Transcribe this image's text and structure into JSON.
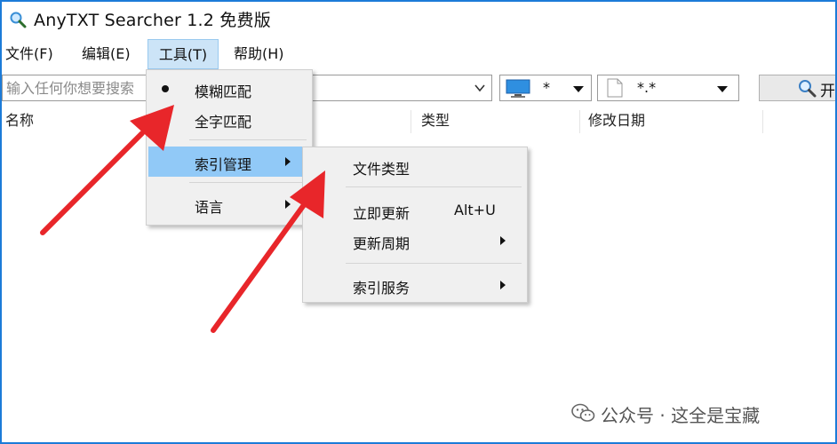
{
  "window": {
    "title": "AnyTXT Searcher 1.2 免费版"
  },
  "menubar": {
    "items": [
      {
        "label": "文件(F)"
      },
      {
        "label": "编辑(E)"
      },
      {
        "label": "工具(T)"
      },
      {
        "label": "帮助(H)"
      }
    ]
  },
  "toolbar": {
    "search_placeholder": "输入任何你想要搜索",
    "location_value": "*",
    "filetype_value": "*.*",
    "search_button_label": "开"
  },
  "columns": [
    "名称",
    "类型",
    "修改日期"
  ],
  "tools_menu": {
    "items": [
      {
        "label": "模糊匹配",
        "checked": true
      },
      {
        "label": "全字匹配"
      },
      {
        "label": "索引管理",
        "highlighted": true,
        "has_submenu": true
      },
      {
        "label": "语言",
        "has_submenu": true
      }
    ]
  },
  "index_submenu": {
    "items": [
      {
        "label": "文件类型"
      },
      {
        "label": "立即更新",
        "accel": "Alt+U"
      },
      {
        "label": "更新周期",
        "has_submenu": true
      },
      {
        "label": "索引服务",
        "has_submenu": true
      }
    ]
  },
  "watermark": {
    "text": "公众号 · 这全是宝藏"
  },
  "colors": {
    "accent": "#1c7bd8",
    "highlight": "#91c9f7",
    "arrow": "#e8262a"
  },
  "icons": [
    "search-icon",
    "monitor-icon",
    "document-icon",
    "wechat-icon"
  ]
}
